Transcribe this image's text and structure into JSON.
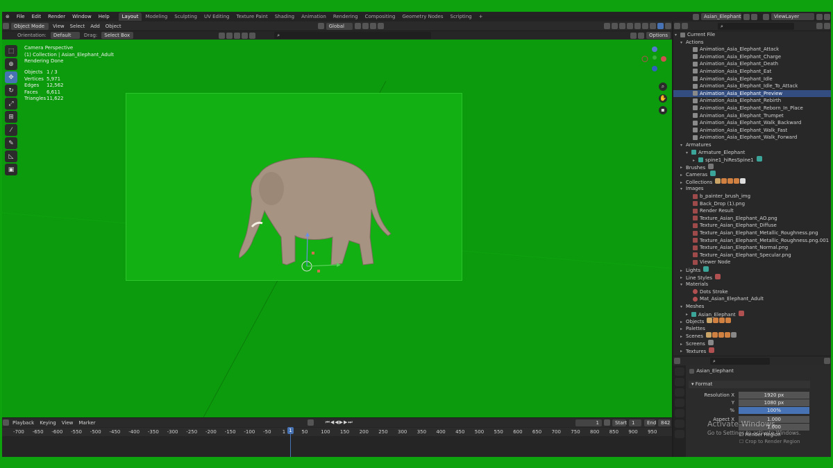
{
  "menu": [
    "File",
    "Edit",
    "Render",
    "Window",
    "Help"
  ],
  "workspaces": [
    "Layout",
    "Modeling",
    "Sculpting",
    "UV Editing",
    "Texture Paint",
    "Shading",
    "Animation",
    "Rendering",
    "Compositing",
    "Geometry Nodes",
    "Scripting",
    "+"
  ],
  "scene_name": "Asian_Elephant",
  "view_layer": "ViewLayer",
  "viewport_header": {
    "mode": "Object Mode",
    "menus": [
      "View",
      "Select",
      "Add",
      "Object"
    ],
    "orientation_label": "Orientation:",
    "orientation_value": "Default",
    "drag_label": "Drag:",
    "drag_value": "Select Box",
    "transform": "Global",
    "options": "Options"
  },
  "viewport_info": {
    "line1": "Camera Perspective",
    "line2": "(1) Collection | Asian_Elephant_Adult",
    "line3": "Rendering Done"
  },
  "stats": [
    {
      "k": "Objects",
      "v": "1 / 3"
    },
    {
      "k": "Vertices",
      "v": "5,971"
    },
    {
      "k": "Edges",
      "v": "12,562"
    },
    {
      "k": "Faces",
      "v": "6,611"
    },
    {
      "k": "Triangles",
      "v": "11,622"
    }
  ],
  "outliner": {
    "root": "Current File",
    "actions_label": "Actions",
    "actions": [
      "Animation_Asia_Elephant_Attack",
      "Animation_Asia_Elephant_Charge",
      "Animation_Asia_Elephant_Death",
      "Animation_Asia_Elephant_Eat",
      "Animation_Asia_Elephant_Idle",
      "Animation_Asia_Elephant_Idle_To_Attack",
      "Animation_Asia_Elephant_Preview",
      "Animation_Asia_Elephant_Rebirth",
      "Animation_Asia_Elephant_Reborn_In_Place",
      "Animation_Asia_Elephant_Trumpet",
      "Animation_Asia_Elephant_Walk_Backward",
      "Animation_Asia_Elephant_Walk_Fast",
      "Animation_Asia_Elephant_Walk_Forward"
    ],
    "selected_action": "Animation_Asia_Elephant_Preview",
    "armatures_label": "Armatures",
    "armature": "Armature_Elephant",
    "spine": "spine1_hiResSpine1",
    "brushes": "Brushes",
    "cameras": "Cameras",
    "collections": "Collections",
    "images_label": "Images",
    "images": [
      "b_painter_brush_img",
      "Back_Drop (1).png",
      "Render Result",
      "Texture_Asian_Elephant_AO.png",
      "Texture_Asian_Elephant_Diffuse",
      "Texture_Asian_Elephant_Metallic_Roughness.png",
      "Texture_Asian_Elephant_Metallic_Roughness.png.001",
      "Texture_Asian_Elephant_Normal.png",
      "Texture_Asian_Elephant_Specular.png",
      "Viewer Node"
    ],
    "lights": "Lights",
    "line_styles": "Line Styles",
    "materials_label": "Materials",
    "materials": [
      "Dots Stroke",
      "Mat_Asian_Elephant_Adult"
    ],
    "meshes_label": "Meshes",
    "mesh": "Asian_Elephant",
    "objects": "Objects",
    "palettes": "Palettes",
    "scenes": "Scenes",
    "screens": "Screens",
    "textures": "Textures"
  },
  "properties": {
    "object": "Asian_Elephant",
    "panel": "Format",
    "resolution_x_label": "Resolution X",
    "resolution_x": "1920 px",
    "y_label": "Y",
    "resolution_y": "1080 px",
    "percent_label": "%",
    "percent": "100%",
    "aspect_x_label": "Aspect X",
    "aspect_x": "1.000",
    "aspect_y": "1.000",
    "render_region": "Render Region",
    "crop": "Crop to Render Region"
  },
  "timeline": {
    "menus": [
      "Playback",
      "Keying",
      "View",
      "Marker"
    ],
    "current_frame": "1",
    "start_label": "Start",
    "start": "1",
    "end_label": "End",
    "end": "842",
    "ticks": [
      "-700",
      "-650",
      "-600",
      "-550",
      "-500",
      "-450",
      "-400",
      "-350",
      "-300",
      "-250",
      "-200",
      "-150",
      "-100",
      "-50",
      "1",
      "50",
      "100",
      "150",
      "200",
      "250",
      "300",
      "350",
      "400",
      "450",
      "500",
      "550",
      "600",
      "650",
      "700",
      "750",
      "800",
      "850",
      "900",
      "950"
    ]
  },
  "watermark": {
    "line1": "Activate Windows",
    "line2": "Go to Settings to activate Windows."
  }
}
